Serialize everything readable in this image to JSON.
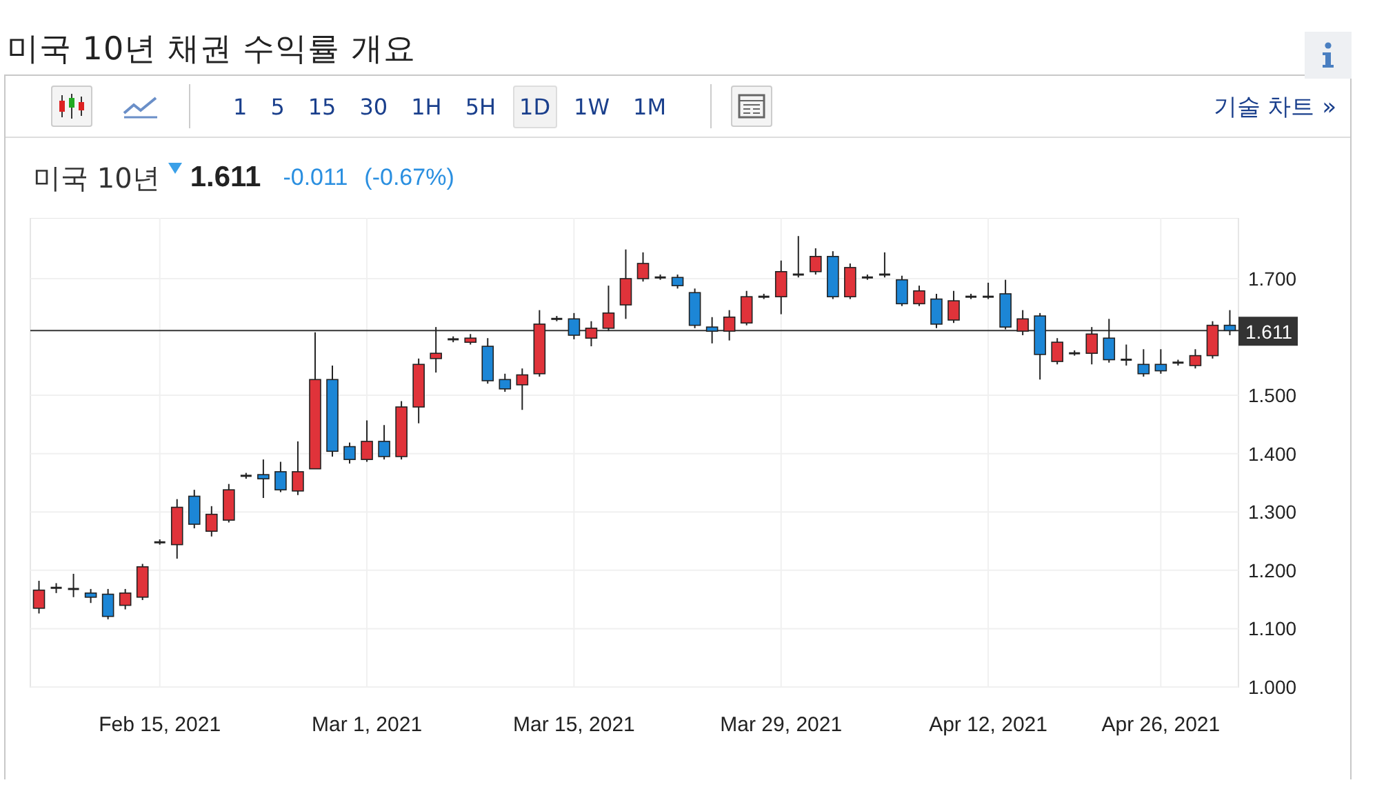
{
  "page_title": "미국 10년 채권 수익률 개요",
  "toolbar": {
    "intervals": [
      {
        "label": "1",
        "selected": false
      },
      {
        "label": "5",
        "selected": false
      },
      {
        "label": "15",
        "selected": false
      },
      {
        "label": "30",
        "selected": false
      },
      {
        "label": "1H",
        "selected": false
      },
      {
        "label": "5H",
        "selected": false
      },
      {
        "label": "1D",
        "selected": true
      },
      {
        "label": "1W",
        "selected": false
      },
      {
        "label": "1M",
        "selected": false
      }
    ],
    "technical_chart_link": "기술 차트 »"
  },
  "quote": {
    "name": "미국 10년",
    "last": "1.611",
    "change": "-0.011",
    "change_percent": "(-0.67%)"
  },
  "chart": {
    "chart_data": {
      "type": "candlestick",
      "grid": true,
      "ref_lines": [
        {
          "axis": "y",
          "value": 1.611,
          "label": "1.611"
        }
      ],
      "ylim": [
        1.0,
        1.804
      ],
      "categories": [
        null,
        null,
        null,
        null,
        null,
        null,
        null,
        "Feb 15, 2021",
        null,
        null,
        null,
        null,
        null,
        null,
        null,
        null,
        null,
        null,
        null,
        "Mar 1, 2021",
        null,
        null,
        null,
        null,
        null,
        null,
        null,
        null,
        null,
        null,
        null,
        "Mar 15, 2021",
        null,
        null,
        null,
        null,
        null,
        null,
        null,
        null,
        null,
        null,
        null,
        "Mar 29, 2021",
        null,
        null,
        null,
        null,
        null,
        null,
        null,
        null,
        null,
        null,
        null,
        "Apr 12, 2021",
        null,
        null,
        null,
        null,
        null,
        null,
        null,
        null,
        null,
        "Apr 26, 2021",
        null,
        null,
        null,
        null
      ],
      "yticks": [
        {
          "value": 1.7,
          "label": "1.700"
        },
        {
          "value": 1.5,
          "label": "1.500"
        },
        {
          "value": 1.4,
          "label": "1.400"
        },
        {
          "value": 1.3,
          "label": "1.300"
        },
        {
          "value": 1.2,
          "label": "1.200"
        },
        {
          "value": 1.1,
          "label": "1.100"
        },
        {
          "value": 1.0,
          "label": "1.000"
        }
      ],
      "ohlc": [
        [
          1.135,
          1.182,
          1.126,
          1.166
        ],
        [
          1.17,
          1.178,
          1.161,
          1.17
        ],
        [
          1.168,
          1.194,
          1.154,
          1.168
        ],
        [
          1.161,
          1.168,
          1.144,
          1.154
        ],
        [
          1.159,
          1.168,
          1.116,
          1.121
        ],
        [
          1.14,
          1.168,
          1.133,
          1.161
        ],
        [
          1.154,
          1.211,
          1.149,
          1.206
        ],
        [
          1.248,
          1.253,
          1.244,
          1.248
        ],
        [
          1.244,
          1.322,
          1.22,
          1.308
        ],
        [
          1.327,
          1.338,
          1.272,
          1.279
        ],
        [
          1.267,
          1.31,
          1.258,
          1.296
        ],
        [
          1.286,
          1.348,
          1.282,
          1.338
        ],
        [
          1.362,
          1.367,
          1.357,
          1.362
        ],
        [
          1.364,
          1.39,
          1.324,
          1.357
        ],
        [
          1.369,
          1.386,
          1.334,
          1.338
        ],
        [
          1.336,
          1.421,
          1.329,
          1.369
        ],
        [
          1.374,
          1.608,
          1.374,
          1.527
        ],
        [
          1.527,
          1.551,
          1.395,
          1.404
        ],
        [
          1.412,
          1.419,
          1.383,
          1.39
        ],
        [
          1.39,
          1.457,
          1.386,
          1.421
        ],
        [
          1.421,
          1.449,
          1.39,
          1.395
        ],
        [
          1.395,
          1.49,
          1.39,
          1.48
        ],
        [
          1.48,
          1.563,
          1.452,
          1.553
        ],
        [
          1.563,
          1.617,
          1.539,
          1.572
        ],
        [
          1.596,
          1.601,
          1.591,
          1.596
        ],
        [
          1.594,
          1.605,
          1.587,
          1.598
        ],
        [
          1.584,
          1.598,
          1.52,
          1.525
        ],
        [
          1.527,
          1.537,
          1.506,
          1.511
        ],
        [
          1.518,
          1.546,
          1.475,
          1.535
        ],
        [
          1.537,
          1.646,
          1.532,
          1.622
        ],
        [
          1.631,
          1.636,
          1.627,
          1.631
        ],
        [
          1.631,
          1.641,
          1.596,
          1.603
        ],
        [
          1.598,
          1.627,
          1.584,
          1.615
        ],
        [
          1.615,
          1.688,
          1.61,
          1.641
        ],
        [
          1.655,
          1.75,
          1.631,
          1.7
        ],
        [
          1.7,
          1.745,
          1.695,
          1.726
        ],
        [
          1.702,
          1.707,
          1.698,
          1.702
        ],
        [
          1.702,
          1.707,
          1.683,
          1.688
        ],
        [
          1.676,
          1.683,
          1.615,
          1.62
        ],
        [
          1.617,
          1.634,
          1.589,
          1.61
        ],
        [
          1.61,
          1.646,
          1.594,
          1.634
        ],
        [
          1.624,
          1.679,
          1.62,
          1.669
        ],
        [
          1.669,
          1.674,
          1.665,
          1.669
        ],
        [
          1.669,
          1.731,
          1.639,
          1.712
        ],
        [
          1.707,
          1.773,
          1.702,
          1.707
        ],
        [
          1.712,
          1.752,
          1.707,
          1.738
        ],
        [
          1.738,
          1.747,
          1.665,
          1.669
        ],
        [
          1.669,
          1.726,
          1.665,
          1.719
        ],
        [
          1.702,
          1.707,
          1.698,
          1.702
        ],
        [
          1.707,
          1.745,
          1.702,
          1.707
        ],
        [
          1.698,
          1.705,
          1.653,
          1.657
        ],
        [
          1.657,
          1.688,
          1.653,
          1.679
        ],
        [
          1.665,
          1.674,
          1.615,
          1.622
        ],
        [
          1.629,
          1.679,
          1.624,
          1.662
        ],
        [
          1.669,
          1.674,
          1.665,
          1.669
        ],
        [
          1.669,
          1.693,
          1.665,
          1.669
        ],
        [
          1.674,
          1.698,
          1.613,
          1.617
        ],
        [
          1.61,
          1.646,
          1.603,
          1.631
        ],
        [
          1.636,
          1.641,
          1.527,
          1.57
        ],
        [
          1.558,
          1.598,
          1.553,
          1.591
        ],
        [
          1.572,
          1.577,
          1.568,
          1.572
        ],
        [
          1.572,
          1.617,
          1.553,
          1.605
        ],
        [
          1.598,
          1.631,
          1.556,
          1.561
        ],
        [
          1.561,
          1.587,
          1.551,
          1.561
        ],
        [
          1.553,
          1.579,
          1.532,
          1.537
        ],
        [
          1.553,
          1.579,
          1.537,
          1.542
        ],
        [
          1.556,
          1.561,
          1.551,
          1.556
        ],
        [
          1.551,
          1.579,
          1.546,
          1.568
        ],
        [
          1.568,
          1.627,
          1.563,
          1.62
        ],
        [
          1.62,
          1.646,
          1.603,
          1.611
        ]
      ]
    }
  }
}
